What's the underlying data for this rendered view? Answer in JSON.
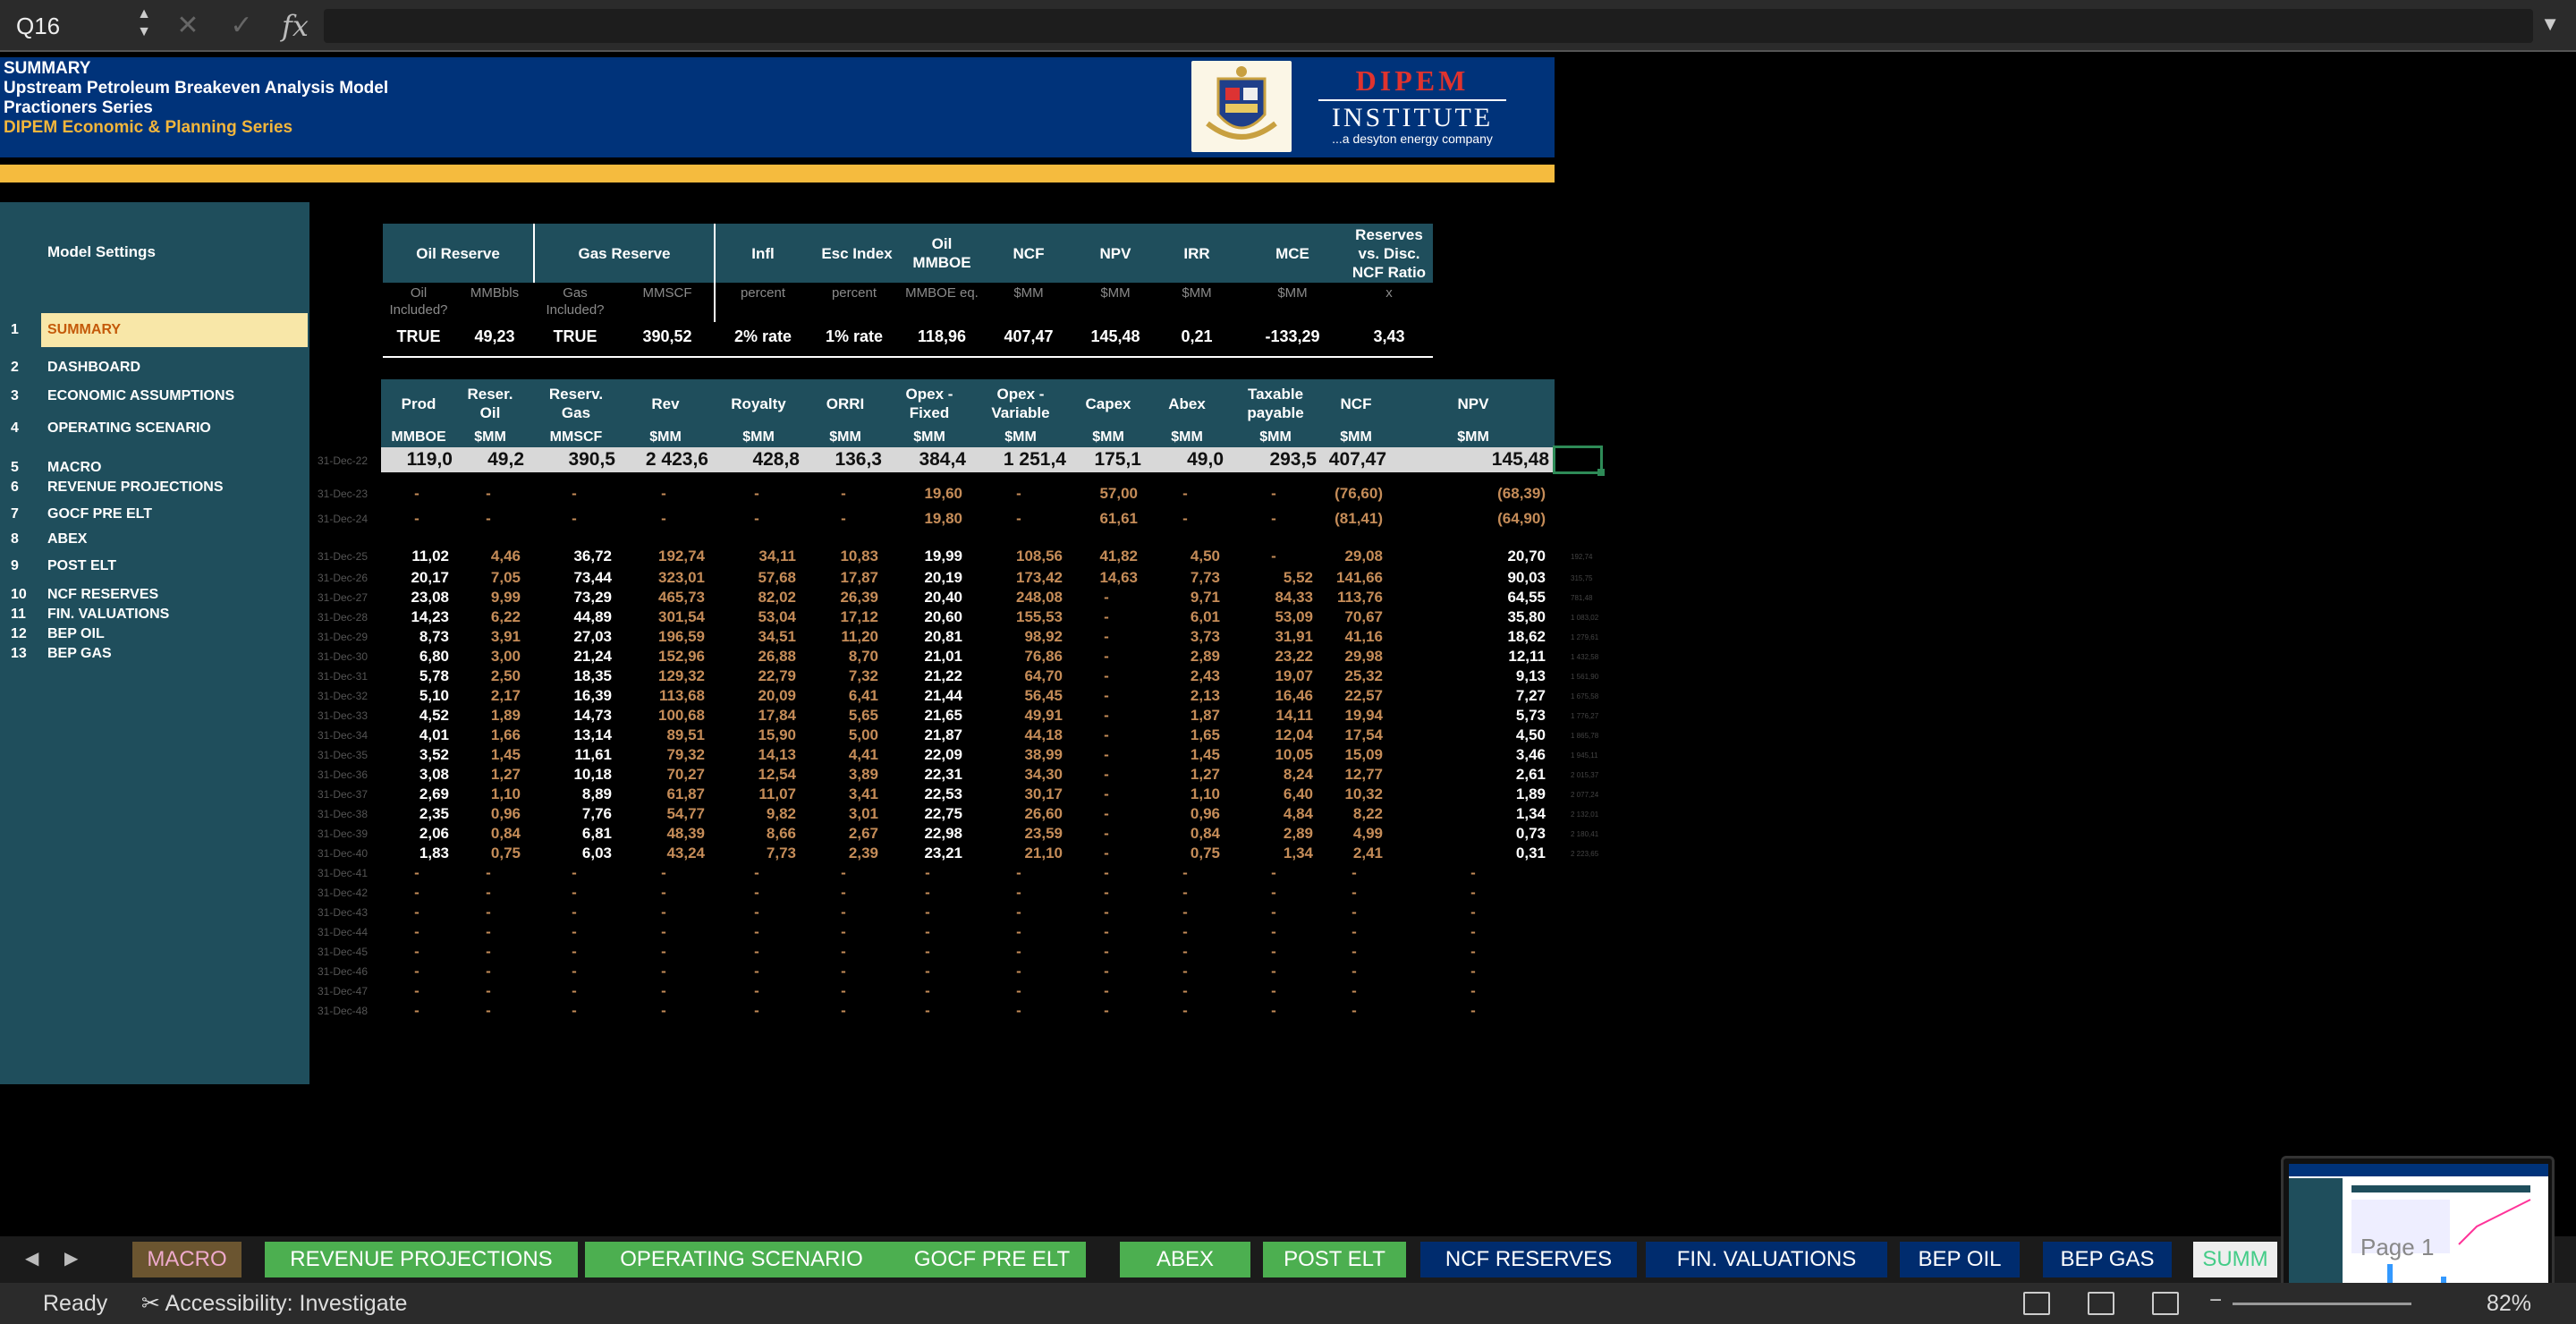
{
  "formula_bar": {
    "cell_ref": "Q16",
    "fx": "fx"
  },
  "header": {
    "lines": [
      "SUMMARY",
      "Upstream Petroleum Breakeven Analysis Model",
      "Practioners Series"
    ],
    "subtitle": "DIPEM Economic & Planning Series",
    "logo_title": "DIPEM",
    "logo_institute": "INSTITUTE",
    "logo_tag": "...a desyton energy company"
  },
  "sidebar": {
    "title": "Model  Settings",
    "items": [
      {
        "num": "1",
        "label": "SUMMARY"
      },
      {
        "num": "2",
        "label": "DASHBOARD"
      },
      {
        "num": "3",
        "label": "ECONOMIC ASSUMPTIONS"
      },
      {
        "num": "4",
        "label": "OPERATING SCENARIO"
      },
      {
        "num": "5",
        "label": "MACRO"
      },
      {
        "num": "6",
        "label": "REVENUE PROJECTIONS"
      },
      {
        "num": "7",
        "label": "GOCF  PRE ELT"
      },
      {
        "num": "8",
        "label": "ABEX"
      },
      {
        "num": "9",
        "label": "POST ELT"
      },
      {
        "num": "10",
        "label": "NCF RESERVES"
      },
      {
        "num": "11",
        "label": "FIN. VALUATIONS"
      },
      {
        "num": "12",
        "label": "BEP OIL"
      },
      {
        "num": "13",
        "label": "BEP GAS"
      }
    ]
  },
  "top_table": {
    "headers": [
      "Oil Reserve",
      "Gas Reserve",
      "Infl",
      "Esc Index",
      "Oil\nMMBOE",
      "NCF",
      "NPV",
      "IRR",
      "MCE",
      "Reserves\nvs. Disc.\nNCF Ratio"
    ],
    "units": [
      "Oil\nIncluded?",
      "MMBbls",
      "Gas\nIncluded?",
      "MMSCF",
      "percent",
      "percent",
      "MMBOE eq.",
      "$MM",
      "$MM",
      "$MM",
      "$MM",
      "x"
    ],
    "values": [
      "TRUE",
      "49,23",
      "TRUE",
      "390,52",
      "2% rate",
      "1% rate",
      "118,96",
      "407,47",
      "145,48",
      "0,21",
      "-133,29",
      "3,43"
    ]
  },
  "main_table": {
    "headers": [
      "Prod",
      "Reser.\nOil",
      "Reserv.\nGas",
      "Rev",
      "Royalty",
      "ORRI",
      "Opex -\nFixed",
      "Opex -\nVariable",
      "Capex",
      "Abex",
      "Taxable\npayable",
      "NCF",
      "NPV"
    ],
    "units": [
      "MMBOE",
      "$MM",
      "MMSCF",
      "$MM",
      "$MM",
      "$MM",
      "$MM",
      "$MM",
      "$MM",
      "$MM",
      "$MM",
      "$MM",
      "$MM"
    ],
    "total_label": "31-Dec-22",
    "totals": [
      "119,0",
      "49,2",
      "390,5",
      "2 423,6",
      "428,8",
      "136,3",
      "384,4",
      "1 251,4",
      "175,1",
      "49,0",
      "293,5",
      "407,47",
      "145,48"
    ],
    "rows": [
      {
        "d": "31-Dec-23",
        "v": [
          "-",
          "-",
          "-",
          "-",
          "-",
          "-",
          "19,60",
          "-",
          "57,00",
          "-",
          "-",
          "(76,60)",
          "(68,39)"
        ]
      },
      {
        "d": "31-Dec-24",
        "v": [
          "-",
          "-",
          "-",
          "-",
          "-",
          "-",
          "19,80",
          "-",
          "61,61",
          "-",
          "-",
          "(81,41)",
          "(64,90)"
        ]
      },
      {
        "d": "31-Dec-25",
        "v": [
          "11,02",
          "4,46",
          "36,72",
          "192,74",
          "34,11",
          "10,83",
          "19,99",
          "108,56",
          "41,82",
          "4,50",
          "-",
          "29,08",
          "20,70"
        ]
      },
      {
        "d": "31-Dec-26",
        "v": [
          "20,17",
          "7,05",
          "73,44",
          "323,01",
          "57,68",
          "17,87",
          "20,19",
          "173,42",
          "14,63",
          "7,73",
          "5,52",
          "141,66",
          "90,03"
        ]
      },
      {
        "d": "31-Dec-27",
        "v": [
          "23,08",
          "9,99",
          "73,29",
          "465,73",
          "82,02",
          "26,39",
          "20,40",
          "248,08",
          "-",
          "9,71",
          "84,33",
          "113,76",
          "64,55"
        ]
      },
      {
        "d": "31-Dec-28",
        "v": [
          "14,23",
          "6,22",
          "44,89",
          "301,54",
          "53,04",
          "17,12",
          "20,60",
          "155,53",
          "-",
          "6,01",
          "53,09",
          "70,67",
          "35,80"
        ]
      },
      {
        "d": "31-Dec-29",
        "v": [
          "8,73",
          "3,91",
          "27,03",
          "196,59",
          "34,51",
          "11,20",
          "20,81",
          "98,92",
          "-",
          "3,73",
          "31,91",
          "41,16",
          "18,62"
        ]
      },
      {
        "d": "31-Dec-30",
        "v": [
          "6,80",
          "3,00",
          "21,24",
          "152,96",
          "26,88",
          "8,70",
          "21,01",
          "76,86",
          "-",
          "2,89",
          "23,22",
          "29,98",
          "12,11"
        ]
      },
      {
        "d": "31-Dec-31",
        "v": [
          "5,78",
          "2,50",
          "18,35",
          "129,32",
          "22,79",
          "7,32",
          "21,22",
          "64,70",
          "-",
          "2,43",
          "19,07",
          "25,32",
          "9,13"
        ]
      },
      {
        "d": "31-Dec-32",
        "v": [
          "5,10",
          "2,17",
          "16,39",
          "113,68",
          "20,09",
          "6,41",
          "21,44",
          "56,45",
          "-",
          "2,13",
          "16,46",
          "22,57",
          "7,27"
        ]
      },
      {
        "d": "31-Dec-33",
        "v": [
          "4,52",
          "1,89",
          "14,73",
          "100,68",
          "17,84",
          "5,65",
          "21,65",
          "49,91",
          "-",
          "1,87",
          "14,11",
          "19,94",
          "5,73"
        ]
      },
      {
        "d": "31-Dec-34",
        "v": [
          "4,01",
          "1,66",
          "13,14",
          "89,51",
          "15,90",
          "5,00",
          "21,87",
          "44,18",
          "-",
          "1,65",
          "12,04",
          "17,54",
          "4,50"
        ]
      },
      {
        "d": "31-Dec-35",
        "v": [
          "3,52",
          "1,45",
          "11,61",
          "79,32",
          "14,13",
          "4,41",
          "22,09",
          "38,99",
          "-",
          "1,45",
          "10,05",
          "15,09",
          "3,46"
        ]
      },
      {
        "d": "31-Dec-36",
        "v": [
          "3,08",
          "1,27",
          "10,18",
          "70,27",
          "12,54",
          "3,89",
          "22,31",
          "34,30",
          "-",
          "1,27",
          "8,24",
          "12,77",
          "2,61"
        ]
      },
      {
        "d": "31-Dec-37",
        "v": [
          "2,69",
          "1,10",
          "8,89",
          "61,87",
          "11,07",
          "3,41",
          "22,53",
          "30,17",
          "-",
          "1,10",
          "6,40",
          "10,32",
          "1,89"
        ]
      },
      {
        "d": "31-Dec-38",
        "v": [
          "2,35",
          "0,96",
          "7,76",
          "54,77",
          "9,82",
          "3,01",
          "22,75",
          "26,60",
          "-",
          "0,96",
          "4,84",
          "8,22",
          "1,34"
        ]
      },
      {
        "d": "31-Dec-39",
        "v": [
          "2,06",
          "0,84",
          "6,81",
          "48,39",
          "8,66",
          "2,67",
          "22,98",
          "23,59",
          "-",
          "0,84",
          "2,89",
          "4,99",
          "0,73"
        ]
      },
      {
        "d": "31-Dec-40",
        "v": [
          "1,83",
          "0,75",
          "6,03",
          "43,24",
          "7,73",
          "2,39",
          "23,21",
          "21,10",
          "-",
          "0,75",
          "1,34",
          "2,41",
          "0,31"
        ]
      },
      {
        "d": "31-Dec-41",
        "v": [
          "-",
          "-",
          "-",
          "-",
          "-",
          "-",
          "-",
          "-",
          "-",
          "-",
          "-",
          "-",
          "-"
        ]
      },
      {
        "d": "31-Dec-42",
        "v": [
          "-",
          "-",
          "-",
          "-",
          "-",
          "-",
          "-",
          "-",
          "-",
          "-",
          "-",
          "-",
          "-"
        ]
      },
      {
        "d": "31-Dec-43",
        "v": [
          "-",
          "-",
          "-",
          "-",
          "-",
          "-",
          "-",
          "-",
          "-",
          "-",
          "-",
          "-",
          "-"
        ]
      },
      {
        "d": "31-Dec-44",
        "v": [
          "-",
          "-",
          "-",
          "-",
          "-",
          "-",
          "-",
          "-",
          "-",
          "-",
          "-",
          "-",
          "-"
        ]
      },
      {
        "d": "31-Dec-45",
        "v": [
          "-",
          "-",
          "-",
          "-",
          "-",
          "-",
          "-",
          "-",
          "-",
          "-",
          "-",
          "-",
          "-"
        ]
      },
      {
        "d": "31-Dec-46",
        "v": [
          "-",
          "-",
          "-",
          "-",
          "-",
          "-",
          "-",
          "-",
          "-",
          "-",
          "-",
          "-",
          "-"
        ]
      },
      {
        "d": "31-Dec-47",
        "v": [
          "-",
          "-",
          "-",
          "-",
          "-",
          "-",
          "-",
          "-",
          "-",
          "-",
          "-",
          "-",
          "-"
        ]
      },
      {
        "d": "31-Dec-48",
        "v": [
          "-",
          "-",
          "-",
          "-",
          "-",
          "-",
          "-",
          "-",
          "-",
          "-",
          "-",
          "-",
          "-"
        ]
      }
    ]
  },
  "side_tiny": [
    "192,74",
    "315,75",
    "781,48",
    "1 083,02",
    "1 279,61",
    "1 432,58",
    "1 561,90",
    "1 675,58",
    "1 776,27",
    "1 865,78",
    "1 945,11",
    "2 015,37",
    "2 077,24",
    "2 132,01",
    "2 180,41",
    "2 223,65"
  ],
  "tabs": [
    "MACRO",
    "REVENUE PROJECTIONS",
    "OPERATING SCENARIO",
    "GOCF  PRE ELT",
    "ABEX",
    "POST ELT",
    "NCF RESERVES",
    "FIN. VALUATIONS",
    "BEP OIL",
    "BEP GAS",
    "SUMM"
  ],
  "status": {
    "ready": "Ready",
    "accessibility": "Accessibility: Investigate",
    "zoom": "82%"
  },
  "thumb_label": "Page 1"
}
